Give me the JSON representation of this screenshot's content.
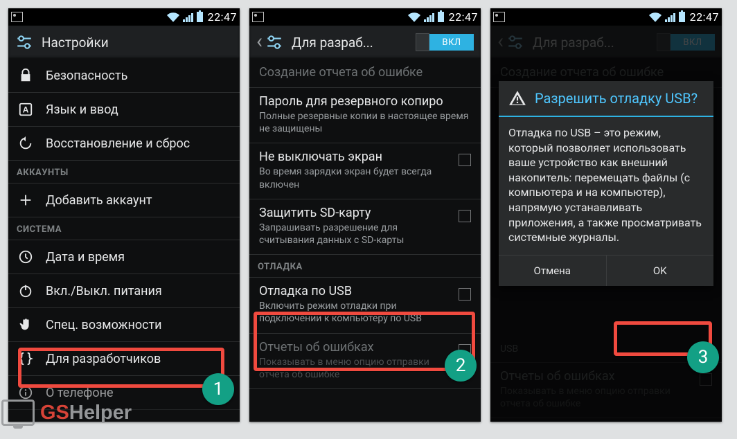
{
  "status": {
    "time": "22:47"
  },
  "screen1": {
    "title": "Настройки",
    "items": [
      {
        "icon": "lock",
        "label": "Безопасность"
      },
      {
        "icon": "lang",
        "label": "Язык и ввод"
      },
      {
        "icon": "restore",
        "label": "Восстановление и сброс"
      }
    ],
    "section_accounts": "АККАУНТЫ",
    "add_account": "Добавить аккаунт",
    "section_system": "СИСТЕМА",
    "sys_items": [
      {
        "icon": "clock",
        "label": "Дата и время"
      },
      {
        "icon": "power",
        "label": "Вкл./Выкл. питания"
      },
      {
        "icon": "hand",
        "label": "Спец. возможности"
      },
      {
        "icon": "braces",
        "label": "Для разработчиков"
      },
      {
        "icon": "info",
        "label": "О телефоне"
      }
    ],
    "step": "1"
  },
  "screen2": {
    "title": "Для разраб...",
    "toggle": "ВКЛ",
    "prefs": [
      {
        "title": "Создание отчета об ошибке",
        "sum": "",
        "cb": false
      },
      {
        "title": "Пароль для резервного копиро",
        "sum": "Полные резервные копии в настоящее время не защищены",
        "cb": false
      },
      {
        "title": "Не выключать экран",
        "sum": "Во время зарядки экран будет всегда включен",
        "cb": true
      },
      {
        "title": "Защитить SD-карту",
        "sum": "Запрашивать разрешение для считывания данных с SD-карты",
        "cb": true
      }
    ],
    "section_debug": "ОТЛАДКА",
    "usb": {
      "title": "Отладка по USB",
      "sum": "Включить режим отладки при подключении к компьютеру по USB"
    },
    "reports": {
      "title": "Отчеты об ошибках",
      "sum": "Показывать в меню опцию отправки отчета об ошибке"
    },
    "step": "2"
  },
  "screen3": {
    "title": "Для разраб...",
    "toggle": "ВКЛ",
    "behind_pref": "Создание отчета об ошибке",
    "dialog": {
      "title": "Разрешить отладку USB?",
      "body": "Отладка по USB – это режим, который позволяет использовать ваше устройство как внешний накопитель: перемещать файлы (с компьютера и на компьютер), напрямую устанавливать приложения, а также просматривать системные журналы.",
      "cancel": "Отмена",
      "ok": "OK"
    },
    "behind_usb": "USB",
    "behind_reports": {
      "title": "Отчеты об ошибках",
      "sum": "Показывать в меню опцию отправки отчета об ошибке"
    },
    "step": "3"
  },
  "watermark": {
    "a": "GS",
    "b": "Helper"
  }
}
